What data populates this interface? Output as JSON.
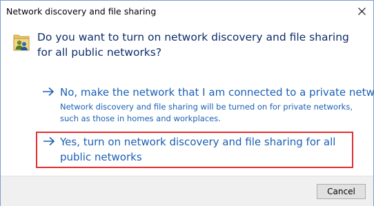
{
  "dialog": {
    "title": "Network discovery and file sharing",
    "question": "Do you want to turn on network discovery and file sharing for all public networks?"
  },
  "options": [
    {
      "main": "No, make the network that I am connected to a private network",
      "sub": "Network discovery and file sharing will be turned on for private networks, such as those in homes and workplaces."
    },
    {
      "main": "Yes, turn on network discovery and file sharing for all public networks",
      "highlighted": true,
      "highlight_color": "#e32c2c"
    }
  ],
  "footer": {
    "cancel_label": "Cancel"
  },
  "icons": {
    "close": "close-icon",
    "app": "network-sharing-icon",
    "arrow": "arrow-right-icon"
  },
  "colors": {
    "link": "#1a5fb4",
    "question": "#0c2b6b",
    "footer_bg": "#f0f0f0"
  }
}
